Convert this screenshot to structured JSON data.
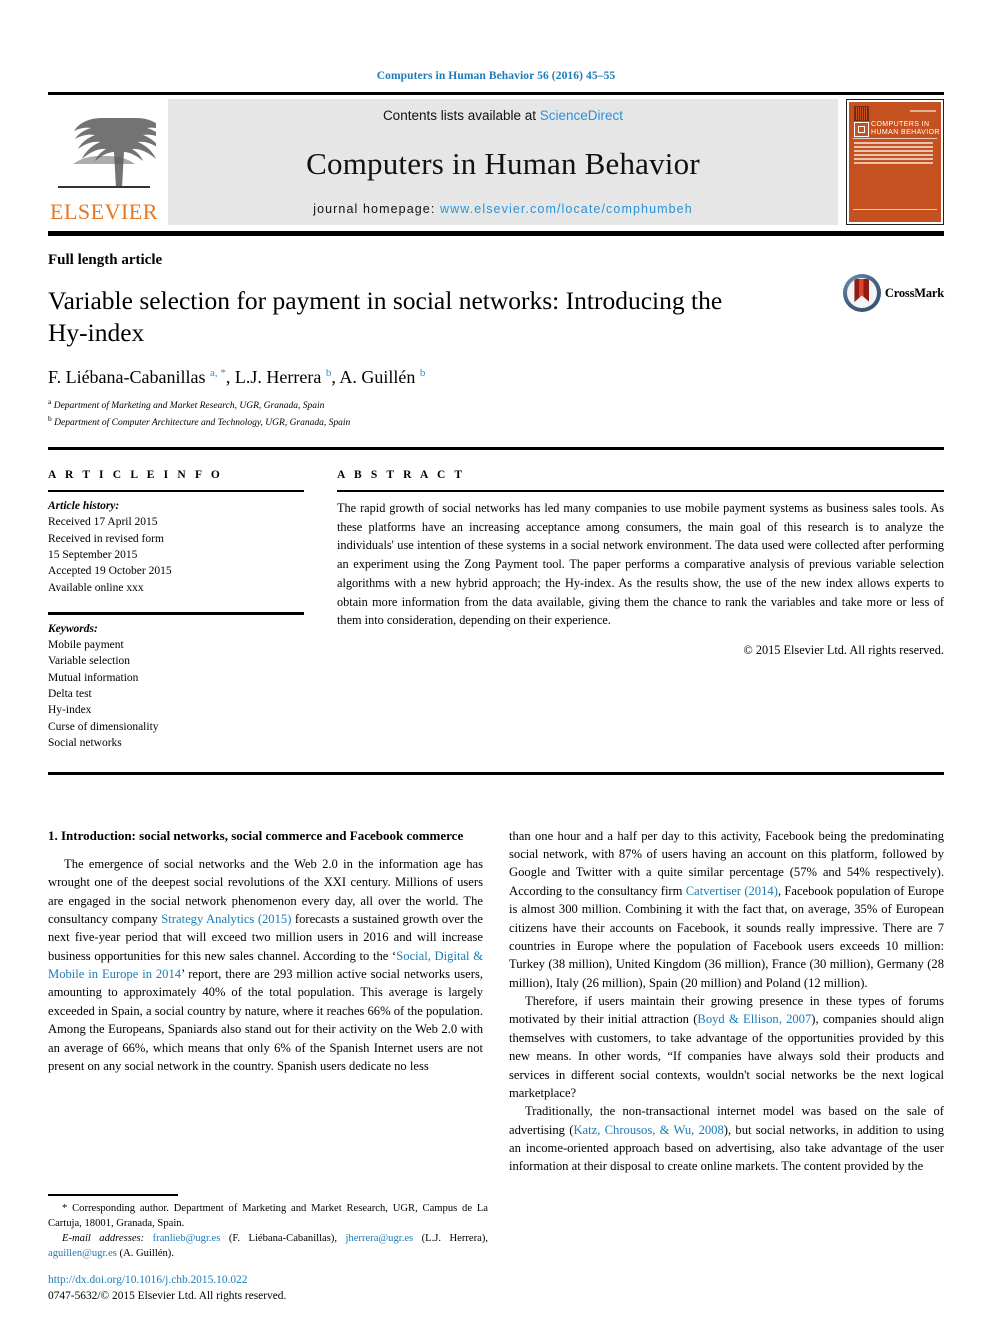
{
  "running_head": "Computers in Human Behavior 56 (2016) 45–55",
  "masthead": {
    "publisher_logo_word": "ELSEVIER",
    "contents_prefix": "Contents lists available at ",
    "contents_link": "ScienceDirect",
    "journal_title": "Computers in Human Behavior",
    "homepage_label": "journal homepage: ",
    "homepage_url": "www.elsevier.com/locate/comphumbeh",
    "cover": {
      "line1": "COMPUTERS IN",
      "line2": "HUMAN BEHAVIOR"
    }
  },
  "article": {
    "kind": "Full length article",
    "title": "Variable selection for payment in social networks: Introducing the Hy-index",
    "authors_html": "F. Liébana-Cabanillas <sup>a, *</sup>, L.J. Herrera <sup>b</sup>, A. Guillén <sup>b</sup>",
    "affiliations": [
      {
        "marker": "a",
        "text": "Department of Marketing and Market Research, UGR, Granada, Spain"
      },
      {
        "marker": "b",
        "text": "Department of Computer Architecture and Technology, UGR, Granada, Spain"
      }
    ],
    "crossmark_label": "CrossMark"
  },
  "info": {
    "heading": "A R T I C L E  I N F O",
    "history_label": "Article history:",
    "history": [
      "Received 17 April 2015",
      "Received in revised form",
      "15 September 2015",
      "Accepted 19 October 2015",
      "Available online xxx"
    ],
    "keywords_label": "Keywords:",
    "keywords": [
      "Mobile payment",
      "Variable selection",
      "Mutual information",
      "Delta test",
      "Hy-index",
      "Curse of dimensionality",
      "Social networks"
    ]
  },
  "abstract": {
    "heading": "A B S T R A C T",
    "text": "The rapid growth of social networks has led many companies to use mobile payment systems as business sales tools. As these platforms have an increasing acceptance among consumers, the main goal of this research is to analyze the individuals' use intention of these systems in a social network environment. The data used were collected after performing an experiment using the Zong Payment tool. The paper performs a comparative analysis of previous variable selection algorithms with a new hybrid approach; the Hy-index. As the results show, the use of the new index allows experts to obtain more information from the data available, giving them the chance to rank the variables and take more or less of them into consideration, depending on their experience.",
    "copyright": "© 2015 Elsevier Ltd. All rights reserved."
  },
  "body": {
    "section_heading": "1. Introduction: social networks, social commerce and Facebook commerce",
    "left_paragraphs": [
      {
        "parts": [
          {
            "t": "The emergence of social networks and the Web 2.0 in the information age has wrought one of the deepest social revolutions of the XXI century. Millions of users are engaged in the social network phenomenon every day, all over the world. The consultancy company "
          },
          {
            "t": "Strategy Analytics (2015)",
            "link": true
          },
          {
            "t": " forecasts a sustained growth over the next five-year period that will exceed two million users in 2016 and will increase business opportunities for this new sales channel. According to the ‘"
          },
          {
            "t": "Social, Digital & Mobile in Europe in 2014",
            "link": true
          },
          {
            "t": "’ report, there are 293 million active social networks users, amounting to approximately 40% of the total population. This average is largely exceeded in Spain, a social country by nature, where it reaches 66% of the population. Among the Europeans, Spaniards also stand out for their activity on the Web 2.0 with an average of 66%, which means that only 6% of the Spanish Internet users are not present on any social network in the country. Spanish users dedicate no less"
          }
        ]
      }
    ],
    "right_paragraphs": [
      {
        "continued": true,
        "parts": [
          {
            "t": "than one hour and a half per day to this activity, Facebook being the predominating social network, with 87% of users having an account on this platform, followed by Google and Twitter with a quite similar percentage (57% and 54% respectively). According to the consultancy firm "
          },
          {
            "t": "Catvertiser (2014)",
            "link": true
          },
          {
            "t": ", Facebook population of Europe is almost 300 million. Combining it with the fact that, on average, 35% of European citizens have their accounts on Facebook, it sounds really impressive. There are 7 countries in Europe where the population of Facebook users exceeds 10 million: Turkey (38 million), United Kingdom (36 million), France (30 million), Germany (28 million), Italy (26 million), Spain (20 million) and Poland (12 million)."
          }
        ]
      },
      {
        "parts": [
          {
            "t": "Therefore, if users maintain their growing presence in these types of forums motivated by their initial attraction ("
          },
          {
            "t": "Boyd & Ellison, 2007",
            "link": true
          },
          {
            "t": "), companies should align themselves with customers, to take advantage of the opportunities provided by this new means. In other words, “If companies have always sold their products and services in different social contexts, wouldn't social networks be the next logical marketplace?"
          }
        ]
      },
      {
        "parts": [
          {
            "t": "Traditionally, the non-transactional internet model was based on the sale of advertising ("
          },
          {
            "t": "Katz, Chrousos, & Wu, 2008",
            "link": true
          },
          {
            "t": "), but social networks, in addition to using an income-oriented approach based on advertising, also take advantage of the user information at their disposal to create online markets. The content provided by the"
          }
        ]
      }
    ]
  },
  "footnote": {
    "corresponding": "* Corresponding author. Department of Marketing and Market Research, UGR, Campus de La Cartuja, 18001, Granada, Spain.",
    "email_label": "E-mail addresses:",
    "emails": [
      {
        "address": "franlieb@ugr.es",
        "owner": "(F. Liébana-Cabanillas),"
      },
      {
        "address": "jherrera@ugr.es",
        "owner": "(L.J. Herrera),"
      },
      {
        "address": "aguillen@ugr.es",
        "owner": "(A. Guillén)."
      }
    ]
  },
  "bottom": {
    "doi": "http://dx.doi.org/10.1016/j.chb.2015.10.022",
    "issn_line": "0747-5632/© 2015 Elsevier Ltd. All rights reserved."
  },
  "colors": {
    "link_blue": "#1a7bb8",
    "sciencedirect_blue": "#2a93d5",
    "elsevier_orange": "#e87722",
    "cover_orange": "#c4511f"
  }
}
